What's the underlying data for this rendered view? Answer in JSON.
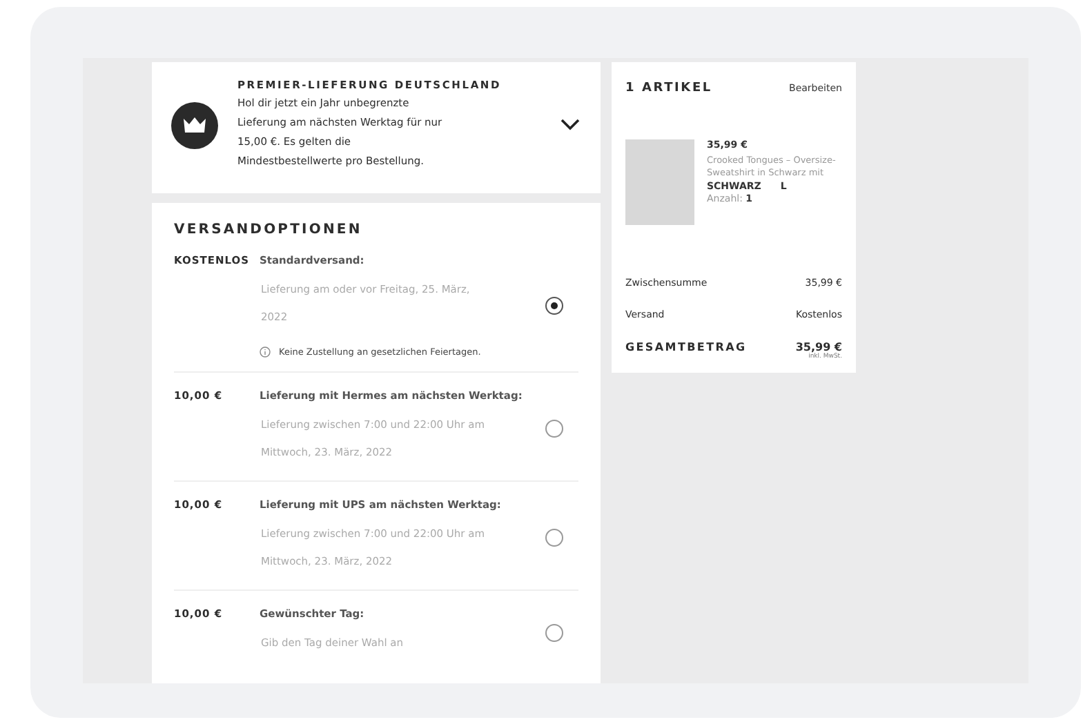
{
  "premier": {
    "title": "PREMIER-LIEFERUNG DEUTSCHLAND",
    "text": "Hol dir jetzt ein Jahr unbegrenzte Lieferung am nächsten Werktag für nur 15,00 €. Es gelten die Mindestbestellwerte pro Bestellung.",
    "expanded": false
  },
  "shipping": {
    "title": "VERSANDOPTIONEN",
    "options": [
      {
        "price": "KOSTENLOS",
        "name": "Standardversand:",
        "detail": "Lieferung am oder vor Freitag, 25. März, 2022",
        "note": "Keine Zustellung an gesetzlichen Feiertagen.",
        "selected": true
      },
      {
        "price": "10,00 €",
        "name": "Lieferung mit Hermes am nächsten Werktag:",
        "detail": "Lieferung zwischen 7:00 und 22:00 Uhr am Mittwoch, 23. März, 2022",
        "selected": false
      },
      {
        "price": "10,00 €",
        "name": "Lieferung mit UPS am nächsten Werktag:",
        "detail": "Lieferung zwischen 7:00 und 22:00 Uhr am Mittwoch, 23. März, 2022",
        "selected": false
      },
      {
        "price": "10,00 €",
        "name": "Gewünschter Tag:",
        "detail": "Gib den Tag deiner Wahl an",
        "selected": false
      }
    ]
  },
  "cart": {
    "title": "1 ARTIKEL",
    "edit": "Bearbeiten",
    "item": {
      "price": "35,99 €",
      "name": "Crooked Tongues – Oversize-Sweatshirt in Schwarz mit",
      "variant": "SCHWARZ",
      "size": "L",
      "quantity": "Anzahl: **1**"
    },
    "subtotal_label": "Zwischensumme",
    "subtotal": "35,99 €",
    "shipping_label": "Versand",
    "shipping": "Kostenlos",
    "total_label": "GESAMTBETRAG",
    "total": "35,99 €",
    "tax_note": "inkl. MwSt."
  }
}
